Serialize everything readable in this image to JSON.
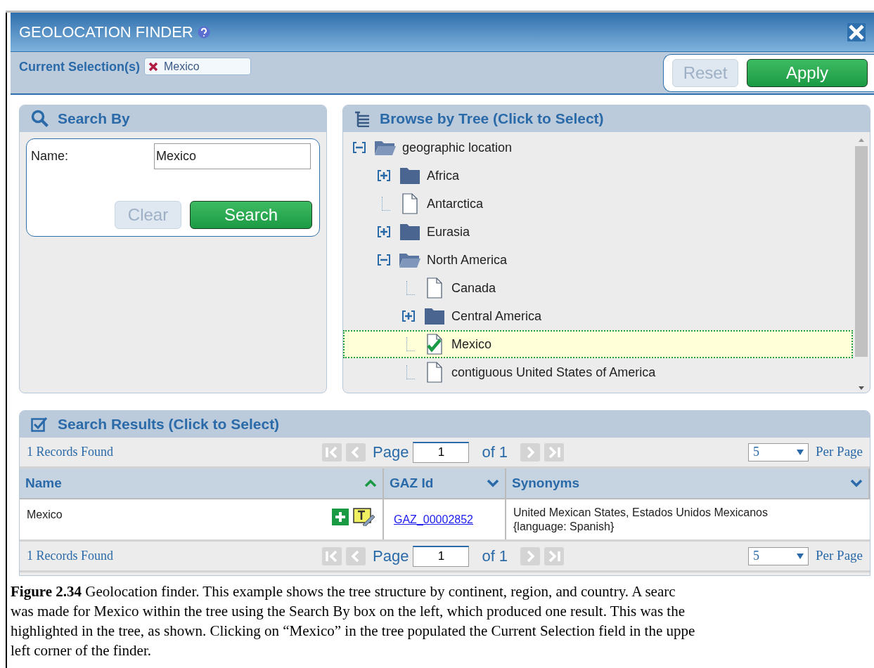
{
  "window": {
    "title": "GEOLOCATION FINDER"
  },
  "current_selection": {
    "label": "Current Selection(s)",
    "chips": [
      "Mexico"
    ]
  },
  "actions": [
    {
      "label": "Reset",
      "kind": "secondary"
    },
    {
      "label": "Apply",
      "kind": "primary"
    }
  ],
  "search_by": {
    "title": "Search By",
    "field_label": "Name:",
    "value": "Mexico",
    "buttons": [
      {
        "label": "Clear",
        "kind": "secondary"
      },
      {
        "label": "Search",
        "kind": "primary"
      }
    ]
  },
  "browse_tree": {
    "title": "Browse by Tree (Click to Select)",
    "nodes": [
      {
        "label": "geographic location",
        "kind": "folder",
        "expanded": true,
        "selected": false,
        "children": [
          {
            "label": "Africa",
            "kind": "folder",
            "expanded": false,
            "selected": false
          },
          {
            "label": "Antarctica",
            "kind": "file",
            "selected": false
          },
          {
            "label": "Eurasia",
            "kind": "folder",
            "expanded": false,
            "selected": false
          },
          {
            "label": "North America",
            "kind": "folder",
            "expanded": true,
            "selected": false,
            "children": [
              {
                "label": "Canada",
                "kind": "file",
                "selected": false
              },
              {
                "label": "Central America",
                "kind": "folder",
                "expanded": false,
                "selected": false
              },
              {
                "label": "Mexico",
                "kind": "file",
                "selected": true
              },
              {
                "label": "contiguous United States of America",
                "kind": "file",
                "selected": false
              }
            ]
          }
        ]
      }
    ]
  },
  "search_results": {
    "title": "Search Results (Click to Select)",
    "pagers": [
      {
        "records": "1 Records Found",
        "page_label": "Page",
        "page": "1",
        "of": "of 1",
        "per_page": "5",
        "per_page_label": "Per Page"
      },
      {
        "records": "1 Records Found",
        "page_label": "Page",
        "page": "1",
        "of": "of 1",
        "per_page": "5",
        "per_page_label": "Per Page"
      }
    ],
    "columns": [
      {
        "label": "Name",
        "sorted": true
      },
      {
        "label": "GAZ Id",
        "sorted": false
      },
      {
        "label": "Synonyms",
        "sorted": false
      }
    ],
    "rows": [
      {
        "name": "Mexico",
        "gaz_id": "GAZ_00002852",
        "synonyms": [
          "United Mexican States, Estados Unidos Mexicanos",
          "{language: Spanish}"
        ]
      }
    ]
  },
  "caption": [
    "**Figure 2.34** Geolocation finder. This example shows the tree structure by continent, region, and country. A searc",
    "was made for Mexico within the tree using the Search By box on the left, which produced one result. This was the",
    "highlighted in the tree, as shown. Clicking on “Mexico” in the tree populated the Current Selection field in the uppe",
    "left corner of the finder."
  ]
}
